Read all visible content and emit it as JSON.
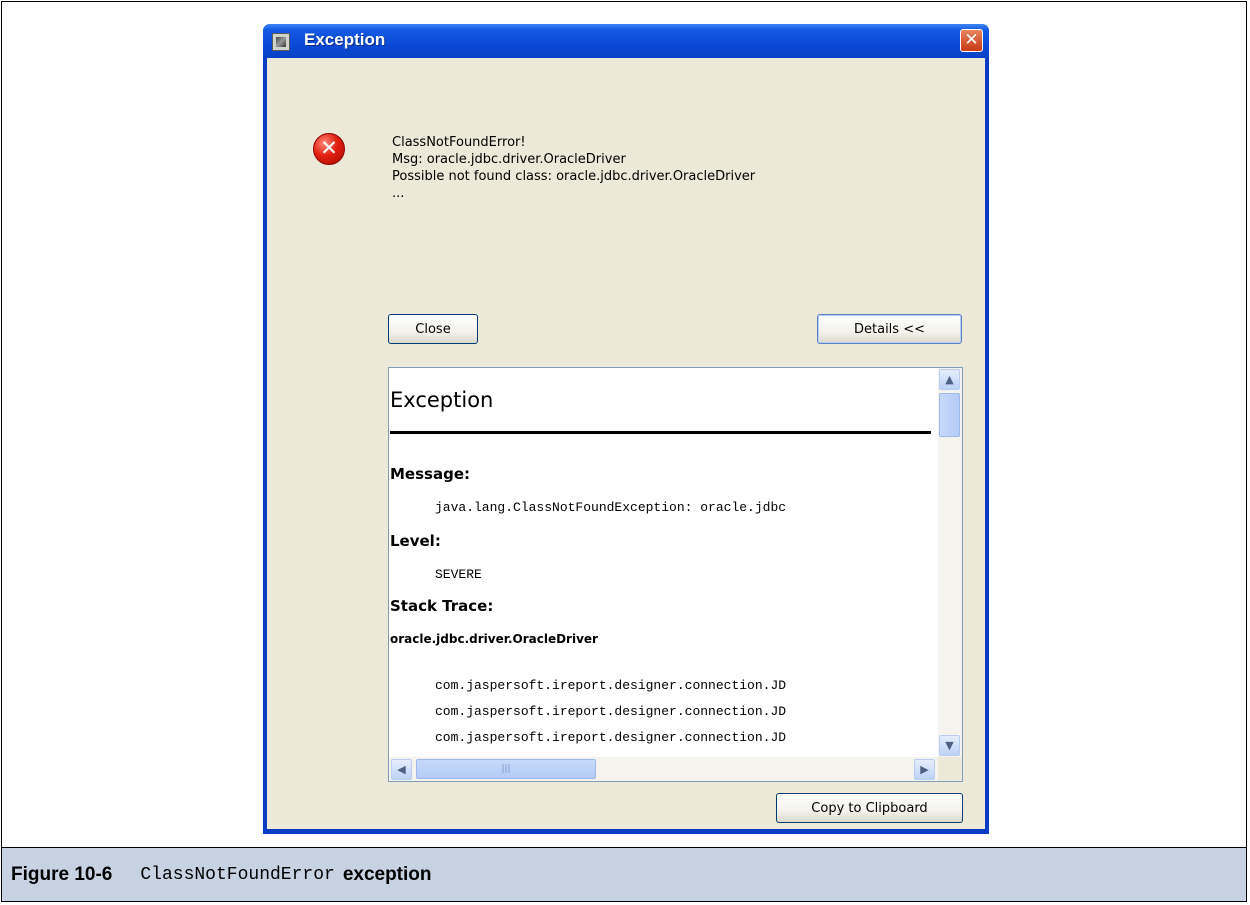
{
  "window": {
    "title": "Exception",
    "close_glyph": "✕"
  },
  "message": {
    "lines": [
      "ClassNotFoundError!",
      "Msg: oracle.jdbc.driver.OracleDriver",
      "Possible not found class: oracle.jdbc.driver.OracleDriver",
      "..."
    ],
    "error_glyph": "✕"
  },
  "buttons": {
    "close_label": "Close",
    "details_label": "Details <<",
    "copy_label": "Copy to Clipboard"
  },
  "details": {
    "heading": "Exception",
    "message_label": "Message:",
    "message_value": "java.lang.ClassNotFoundException: oracle.jdbc",
    "level_label": "Level:",
    "level_value": "SEVERE",
    "stack_label": "Stack Trace:",
    "stack_class": "oracle.jdbc.driver.OracleDriver",
    "stack_lines": [
      "com.jaspersoft.ireport.designer.connection.JD",
      "com.jaspersoft.ireport.designer.connection.JD",
      "com.jaspersoft.ireport.designer.connection.JD"
    ]
  },
  "scrollbars": {
    "up": "▲",
    "down": "▼",
    "left": "◀",
    "right": "▶",
    "grip": "|||"
  },
  "caption": {
    "number": "Figure 10-6",
    "code": "ClassNotFoundError",
    "text": "exception"
  }
}
